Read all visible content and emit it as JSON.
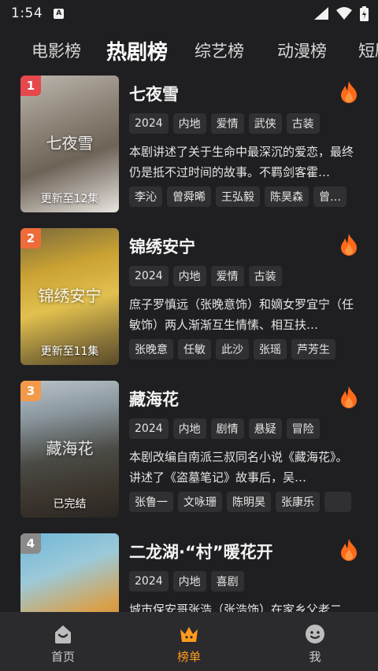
{
  "status_bar": {
    "time": "1:54",
    "badge": "A"
  },
  "tabs": [
    {
      "label": "电影榜",
      "active": false
    },
    {
      "label": "热剧榜",
      "active": true
    },
    {
      "label": "综艺榜",
      "active": false
    },
    {
      "label": "动漫榜",
      "active": false
    },
    {
      "label": "短剧",
      "active": false
    }
  ],
  "colors": {
    "accent": "#ff9a1f",
    "rank_1": "#e5484d",
    "rank_2": "#ef6b3a",
    "rank_3": "#f2994a",
    "rank_4": "#8a8a8a",
    "flame": "#ff6a1a"
  },
  "items": [
    {
      "rank": "1",
      "title": "七夜雪",
      "poster_title": "七夜雪",
      "poster_status": "更新至12集",
      "tags": [
        "2024",
        "内地",
        "爱情",
        "武侠",
        "古装"
      ],
      "desc": "本剧讲述了关于生命中最深沉的爱恋，最终仍是抵不过时间的故事。不羁剑客霍…",
      "cast": [
        "李沁",
        "曾舜晞",
        "王弘毅",
        "陈昊森",
        "曾…"
      ]
    },
    {
      "rank": "2",
      "title": "锦绣安宁",
      "poster_title": "锦绣安宁",
      "poster_status": "更新至11集",
      "tags": [
        "2024",
        "内地",
        "爱情",
        "古装"
      ],
      "desc": "庶子罗慎远（张晚意饰）和嫡女罗宜宁（任敏饰）两人渐渐互生情愫、相互扶…",
      "cast": [
        "张晚意",
        "任敏",
        "此沙",
        "张瑶",
        "芦芳生"
      ]
    },
    {
      "rank": "3",
      "title": "藏海花",
      "poster_title": "藏海花",
      "poster_status": "已完结",
      "tags": [
        "2024",
        "内地",
        "剧情",
        "悬疑",
        "冒险"
      ],
      "desc": "本剧改编自南派三叔同名小说《藏海花》。讲述了《盗墓笔记》故事后，吴…",
      "cast": [
        "张鲁一",
        "文咏珊",
        "陈明昊",
        "张康乐",
        ""
      ]
    },
    {
      "rank": "4",
      "title": "二龙湖·“村”暖花开",
      "poster_title": "",
      "poster_status": "",
      "tags": [
        "2024",
        "内地",
        "喜剧"
      ],
      "desc": "城市保安哥张浩（张浩饰）在家乡父老二…",
      "cast": []
    }
  ],
  "bottom_nav": [
    {
      "label": "首页",
      "icon": "home-icon",
      "active": false
    },
    {
      "label": "榜单",
      "icon": "crown-icon",
      "active": true
    },
    {
      "label": "我",
      "icon": "smile-icon",
      "active": false
    }
  ]
}
